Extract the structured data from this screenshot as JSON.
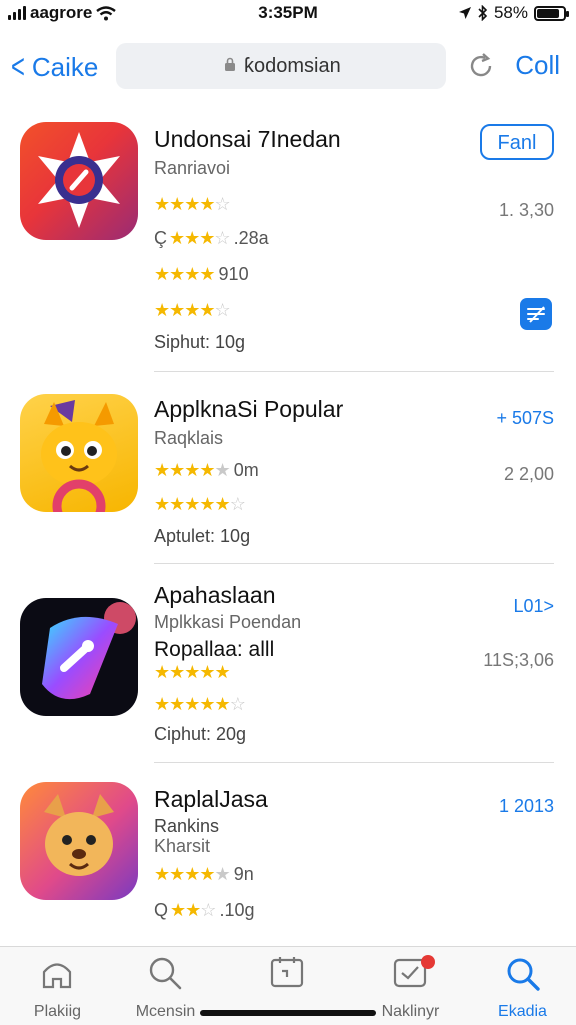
{
  "status": {
    "carrier": "aagrore",
    "time": "3:35PM",
    "battery": "58%",
    "battery_level": 0.85
  },
  "nav": {
    "back_label": "Caike",
    "url": "ƙodomsian",
    "right_label": "Coll"
  },
  "apps": [
    {
      "title": "Undonsai 7Inedan",
      "subtitle": "Ranriavoi",
      "rows": [
        {
          "stars": "★★★★",
          "empty": "☆",
          "text": ""
        },
        {
          "stars": "★★★",
          "empty": "☆",
          "prefix": "Ç",
          "text": ".28a"
        },
        {
          "stars": "★★★★",
          "empty": "",
          "text": "910"
        },
        {
          "stars": "★★★★",
          "empty": "☆",
          "text": ""
        }
      ],
      "footer": "Siphut: 10g",
      "button": "Fanl",
      "meta": "1. 3,30"
    },
    {
      "title": "ApplknaSi Popular",
      "subtitle": "Raqklais",
      "rows": [
        {
          "stars": "★★★★",
          "empty": "★",
          "text": "0m"
        },
        {
          "stars": "★★★★★",
          "empty": "☆",
          "text": ""
        }
      ],
      "footer": "Aptulet: 10g",
      "meta_blue": "+ 507S",
      "meta": "2 2,00"
    },
    {
      "title": "Apahaslaan",
      "subtitle": "Mplkkasi Poendan",
      "line": "Ropallaa: alll",
      "rows": [
        {
          "stars": "★★★★★",
          "empty": "",
          "text": ""
        },
        {
          "stars": "★★★★★",
          "empty": "☆",
          "text": ""
        }
      ],
      "footer": "Ciphut: 20g",
      "meta_blue": "L01>",
      "meta": "11S;3,06"
    },
    {
      "title": "RaplalJasa",
      "subtitle": "Rankins",
      "subtitle2": "Kharsit",
      "rows": [
        {
          "stars": "★★★★",
          "empty": "★",
          "text": "9n"
        },
        {
          "stars": "★★",
          "empty": "☆",
          "prefix": "Q",
          "text": ".10g"
        }
      ],
      "meta_blue": "1 2013"
    }
  ],
  "tabs": [
    {
      "label": "Plakiig",
      "icon": "home-icon"
    },
    {
      "label": "Mcensin",
      "icon": "search-icon"
    },
    {
      "label": "",
      "icon": "calendar-icon"
    },
    {
      "label": "Naklinyr",
      "icon": "updates-icon"
    },
    {
      "label": "Ekadia",
      "icon": "search-active-icon"
    }
  ],
  "colors": {
    "accent": "#1a7ae8",
    "star": "#f5b800",
    "badge": "#e53935"
  }
}
